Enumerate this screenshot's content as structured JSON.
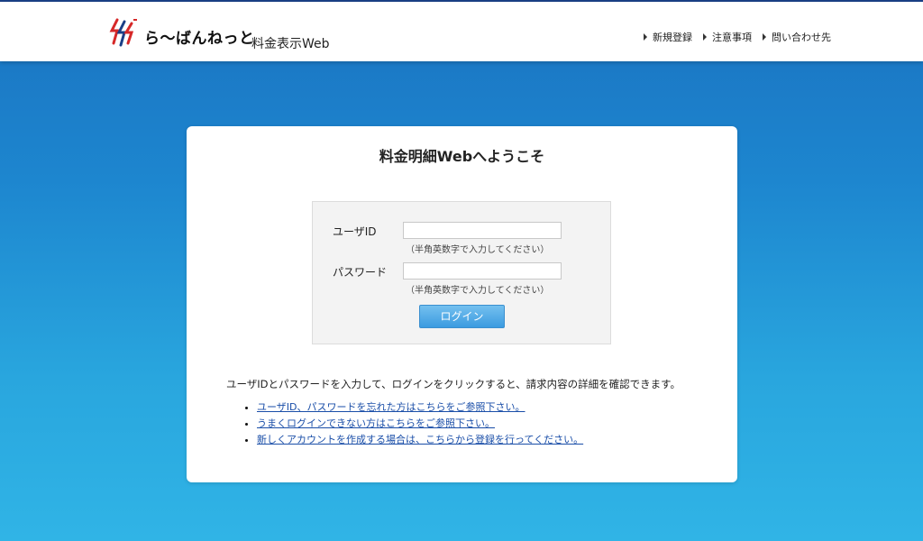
{
  "header": {
    "brand": "ら〜ばんねっと",
    "app_title": "料金表示Web",
    "links": [
      "新規登録",
      "注意事項",
      "問い合わせ先"
    ]
  },
  "card": {
    "title": "料金明細Webへようこそ",
    "form": {
      "user_id_label": "ユーザID",
      "user_id_value": "",
      "user_id_hint": "（半角英数字で入力してください）",
      "password_label": "パスワード",
      "password_value": "",
      "password_hint": "（半角英数字で入力してください）",
      "login_button": "ログイン"
    },
    "description": "ユーザIDとパスワードを入力して、ログインをクリックすると、請求内容の詳細を確認できます。",
    "help_links": [
      "ユーザID、パスワードを忘れた方はこちらをご参照下さい。",
      "うまくログインできない方はこちらをご参照下さい。",
      "新しくアカウントを作成する場合は、こちらから登録を行ってください。"
    ]
  },
  "colors": {
    "accent": "#3b9be0",
    "link": "#1a4ea8",
    "background_top": "#1a73c1",
    "background_bottom": "#30b4e6"
  }
}
